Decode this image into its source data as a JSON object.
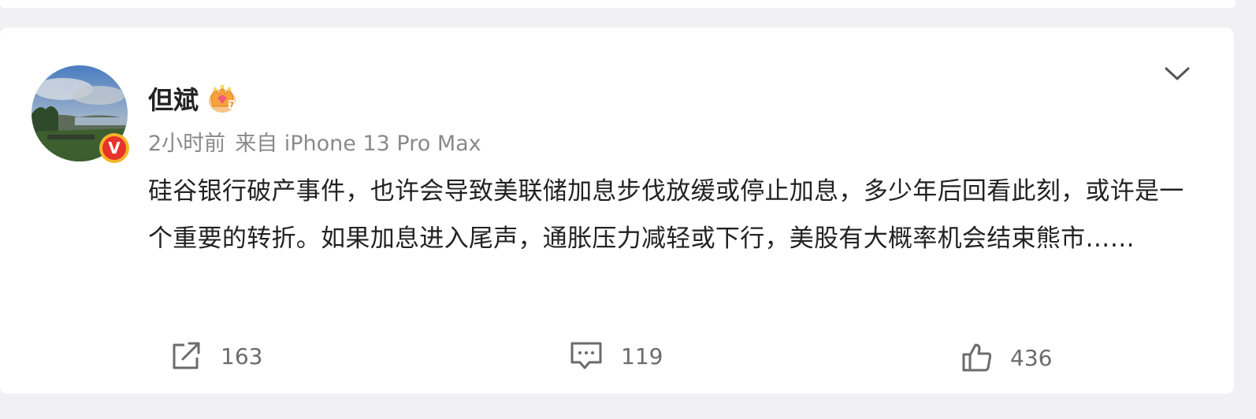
{
  "post": {
    "author": {
      "name": "但斌",
      "avatar_icon": "landscape-avatar",
      "verified_badge": "V",
      "member_badge_icon": "crown-icon"
    },
    "time": "2小时前",
    "source": "来自 iPhone 13 Pro Max",
    "content": "硅谷银行破产事件，也许会导致美联储加息步伐放缓或停止加息，多少年后回看此刻，或许是一个重要的转折。如果加息进入尾声，通胀压力减轻或下行，美股有大概率机会结束熊市……",
    "menu_icon": "chevron-down-icon",
    "actions": {
      "repost": {
        "icon": "share-icon",
        "count": "163"
      },
      "comment": {
        "icon": "comment-icon",
        "count": "119"
      },
      "like": {
        "icon": "thumbs-up-icon",
        "count": "436"
      }
    }
  },
  "colors": {
    "background": "#f1f1f3",
    "card": "#ffffff",
    "text": "#222222",
    "meta_text": "#8a8a8a",
    "icon": "#6b6b6b",
    "verified_red": "#e8332b",
    "verified_gold": "#f2b529"
  }
}
